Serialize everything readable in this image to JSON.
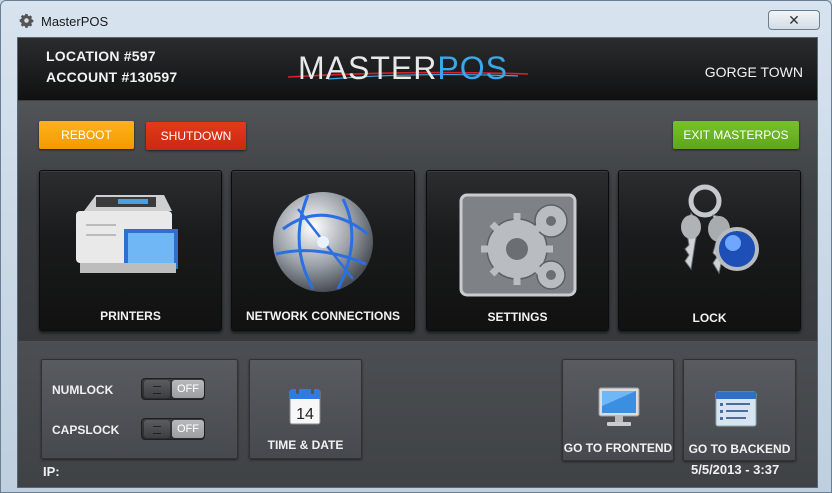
{
  "window": {
    "title": "MasterPOS",
    "close_glyph": "✕"
  },
  "header": {
    "location": "LOCATION #597",
    "account": "ACCOUNT #130597",
    "logo_left": "MASTER",
    "logo_right": "POS",
    "town": "GORGE TOWN"
  },
  "actions": {
    "reboot": "REBOOT",
    "shutdown": "SHUTDOWN",
    "exit": "EXIT MASTERPOS"
  },
  "tiles": [
    {
      "label": "PRINTERS",
      "icon": "printer-icon"
    },
    {
      "label": "NETWORK CONNECTIONS",
      "icon": "globe-network-icon"
    },
    {
      "label": "SETTINGS",
      "icon": "gears-icon"
    },
    {
      "label": "LOCK",
      "icon": "keys-icon"
    }
  ],
  "keyboard": {
    "numlock_label": "NUMLOCK",
    "numlock_state": "OFF",
    "capslock_label": "CAPSLOCK",
    "capslock_state": "OFF"
  },
  "time_date": {
    "label": "TIME & DATE",
    "calendar_day": "14",
    "icon": "calendar-icon"
  },
  "frontend": {
    "label": "GO TO FRONTEND",
    "icon": "monitor-icon"
  },
  "backend": {
    "label": "GO TO BACKEND",
    "icon": "backend-window-icon"
  },
  "status": {
    "ip_label": "IP:",
    "datetime": "5/5/2013 - 3:37"
  },
  "colors": {
    "reboot": "#f7a30a",
    "shutdown": "#d8321a",
    "exit": "#6cb423",
    "logo_accent": "#3aa7e6"
  }
}
